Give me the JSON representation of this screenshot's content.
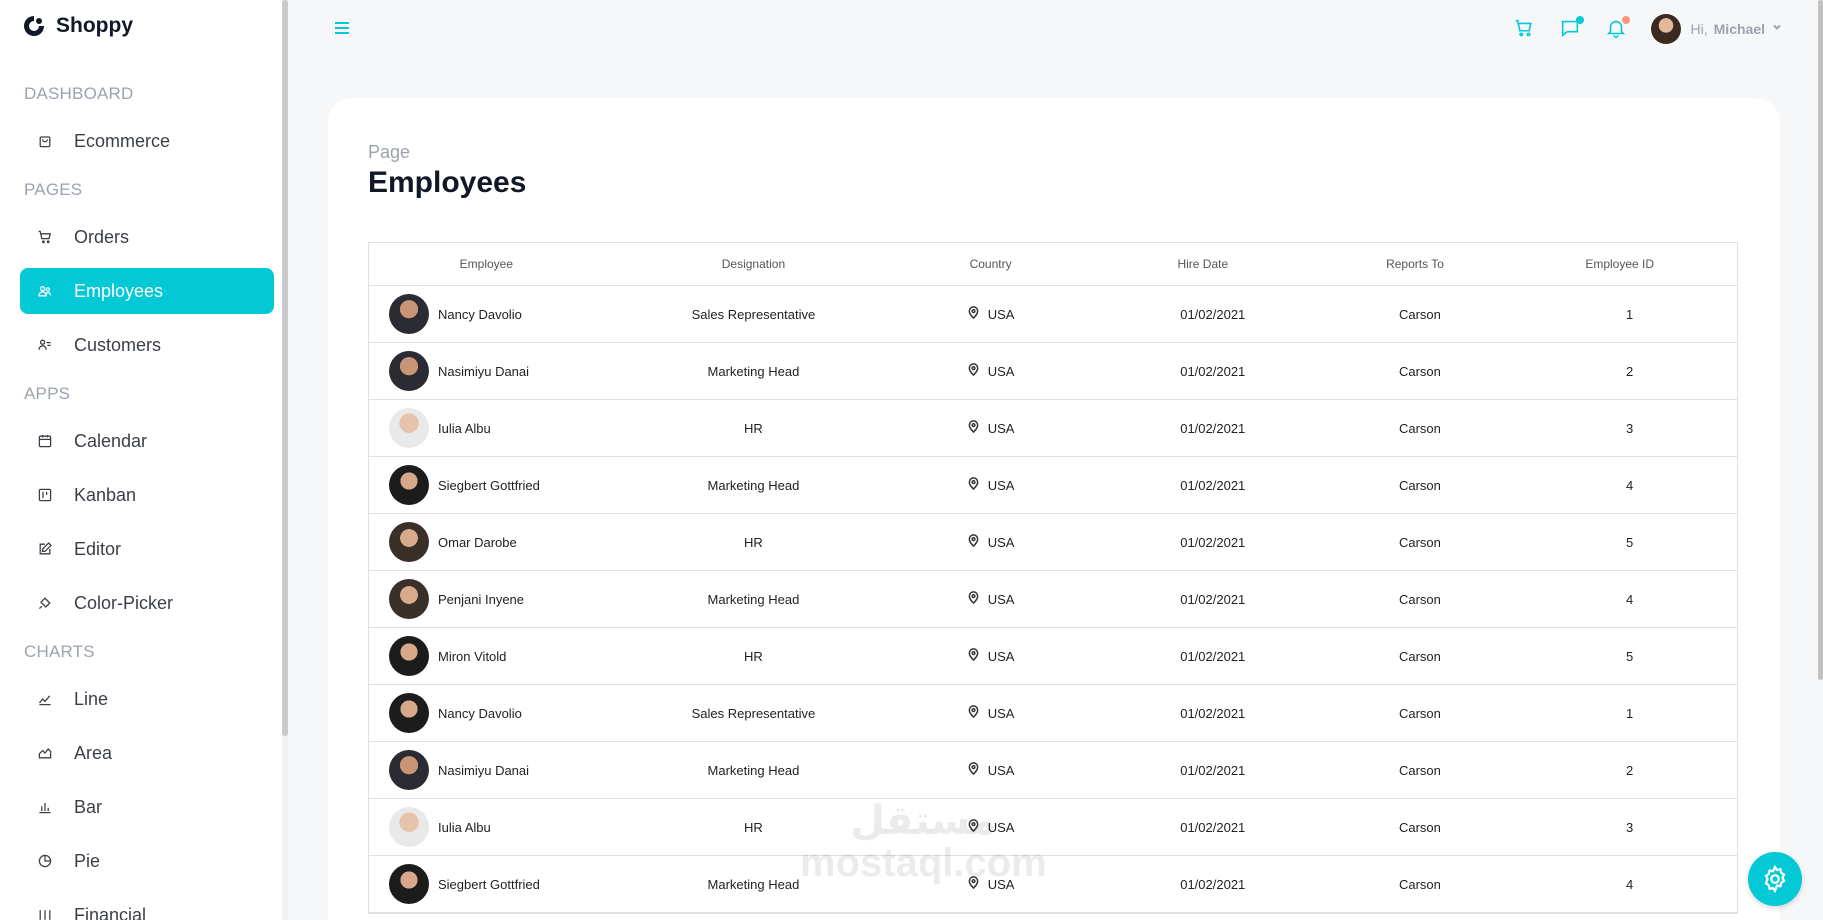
{
  "app": {
    "brand": "Shoppy",
    "accent": "#03c9d7"
  },
  "sidebar": {
    "sections": [
      {
        "title": "DASHBOARD",
        "items": [
          {
            "label": "Ecommerce",
            "icon": "shopping-bag-icon"
          }
        ]
      },
      {
        "title": "PAGES",
        "items": [
          {
            "label": "Orders",
            "icon": "cart-icon"
          },
          {
            "label": "Employees",
            "icon": "people-icon",
            "active": true
          },
          {
            "label": "Customers",
            "icon": "user-list-icon"
          }
        ]
      },
      {
        "title": "APPS",
        "items": [
          {
            "label": "Calendar",
            "icon": "calendar-icon"
          },
          {
            "label": "Kanban",
            "icon": "kanban-icon"
          },
          {
            "label": "Editor",
            "icon": "edit-icon"
          },
          {
            "label": "Color-Picker",
            "icon": "paint-bucket-icon"
          }
        ]
      },
      {
        "title": "CHARTS",
        "items": [
          {
            "label": "Line",
            "icon": "line-chart-icon"
          },
          {
            "label": "Area",
            "icon": "area-chart-icon"
          },
          {
            "label": "Bar",
            "icon": "bar-chart-icon"
          },
          {
            "label": "Pie",
            "icon": "pie-chart-icon"
          },
          {
            "label": "Financial",
            "icon": "financial-icon"
          }
        ]
      }
    ]
  },
  "topbar": {
    "greeting": "Hi,",
    "user_name": "Michael",
    "icons": [
      "cart-icon",
      "chat-icon",
      "bell-icon"
    ],
    "chat_dot_color": "#03c9d7",
    "bell_dot_color": "#fb9678"
  },
  "page": {
    "subtitle": "Page",
    "title": "Employees"
  },
  "table": {
    "columns": [
      "Employee",
      "Designation",
      "Country",
      "Hire Date",
      "Reports To",
      "Employee ID"
    ],
    "rows": [
      {
        "name": "Nancy Davolio",
        "designation": "Sales Representative",
        "country": "USA",
        "hire_date": "01/02/2021",
        "reports_to": "Carson",
        "id": "1"
      },
      {
        "name": "Nasimiyu Danai",
        "designation": "Marketing Head",
        "country": "USA",
        "hire_date": "01/02/2021",
        "reports_to": "Carson",
        "id": "2"
      },
      {
        "name": "Iulia Albu",
        "designation": "HR",
        "country": "USA",
        "hire_date": "01/02/2021",
        "reports_to": "Carson",
        "id": "3"
      },
      {
        "name": "Siegbert Gottfried",
        "designation": "Marketing Head",
        "country": "USA",
        "hire_date": "01/02/2021",
        "reports_to": "Carson",
        "id": "4"
      },
      {
        "name": "Omar Darobe",
        "designation": "HR",
        "country": "USA",
        "hire_date": "01/02/2021",
        "reports_to": "Carson",
        "id": "5"
      },
      {
        "name": "Penjani Inyene",
        "designation": "Marketing Head",
        "country": "USA",
        "hire_date": "01/02/2021",
        "reports_to": "Carson",
        "id": "4"
      },
      {
        "name": "Miron Vitold",
        "designation": "HR",
        "country": "USA",
        "hire_date": "01/02/2021",
        "reports_to": "Carson",
        "id": "5"
      },
      {
        "name": "Nancy Davolio",
        "designation": "Sales Representative",
        "country": "USA",
        "hire_date": "01/02/2021",
        "reports_to": "Carson",
        "id": "1"
      },
      {
        "name": "Nasimiyu Danai",
        "designation": "Marketing Head",
        "country": "USA",
        "hire_date": "01/02/2021",
        "reports_to": "Carson",
        "id": "2"
      },
      {
        "name": "Iulia Albu",
        "designation": "HR",
        "country": "USA",
        "hire_date": "01/02/2021",
        "reports_to": "Carson",
        "id": "3"
      },
      {
        "name": "Siegbert Gottfried",
        "designation": "Marketing Head",
        "country": "USA",
        "hire_date": "01/02/2021",
        "reports_to": "Carson",
        "id": "4"
      }
    ]
  },
  "watermark": {
    "arabic": "مستقل",
    "latin": "mostaql.com"
  }
}
